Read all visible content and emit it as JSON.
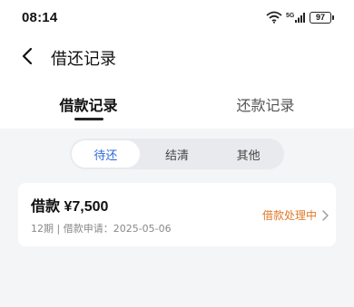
{
  "status_bar": {
    "time": "08:14",
    "battery": "97",
    "network_label": "5G"
  },
  "nav": {
    "title": "借还记录",
    "back_icon": "chevron-left-icon"
  },
  "tabs": [
    {
      "label": "借款记录",
      "active": true
    },
    {
      "label": "还款记录",
      "active": false
    }
  ],
  "segments": [
    {
      "label": "待还",
      "active": true
    },
    {
      "label": "结清",
      "active": false
    },
    {
      "label": "其他",
      "active": false
    }
  ],
  "loan": {
    "title": "借款 ¥7,500",
    "subtitle": "12期 | 借款申请：2025-05-06",
    "status": "借款处理中"
  },
  "colors": {
    "accent": "#2f6ad9",
    "status_orange": "#e0792a",
    "content_bg": "#f4f5f7"
  }
}
